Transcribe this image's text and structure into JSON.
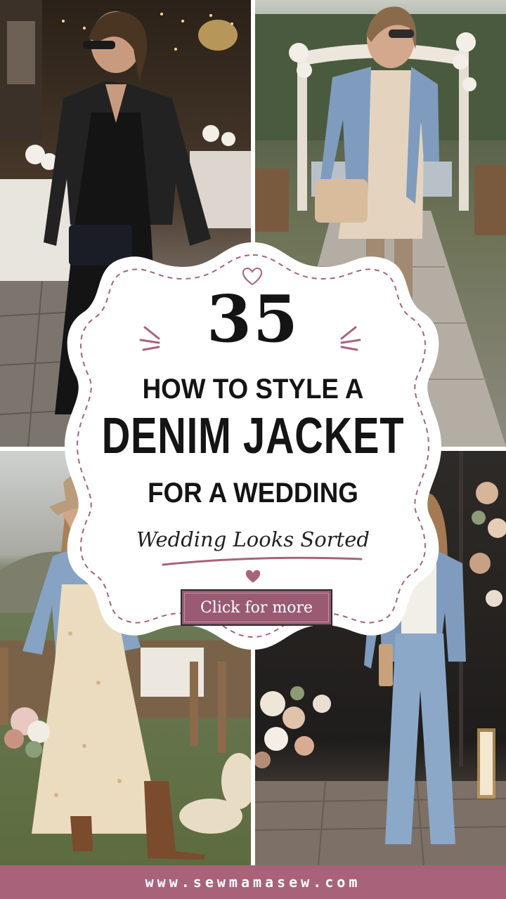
{
  "pin": {
    "number": "35",
    "title_line1": "HOW TO STYLE A",
    "title_line2": "DENIM JACKET",
    "title_line3": "FOR A WEDDING",
    "tagline": "Wedding Looks Sorted",
    "cta_label": "Click for more",
    "footer_url": "www.sewmamasew.com"
  },
  "photos": [
    {
      "id": "top-left",
      "subject": "woman in black denim jacket and black satin dress at evening reception"
    },
    {
      "id": "top-right",
      "subject": "woman in light denim jacket over cream knit dress with tan boots at outdoor aisle"
    },
    {
      "id": "bottom-left",
      "subject": "woman in denim jacket, floral maxi dress, cowboy hat and boots holding bouquet"
    },
    {
      "id": "bottom-right",
      "subject": "woman in denim jacket, white top and straight-leg jeans beside floral arrangement"
    }
  ],
  "icons": [
    "heart-icon",
    "sparkle-lines-left-icon",
    "sparkle-lines-right-icon"
  ],
  "colors": {
    "accent": "#a8637a",
    "button": "#9a5b72",
    "heading": "#141414",
    "card": "#ffffff"
  }
}
